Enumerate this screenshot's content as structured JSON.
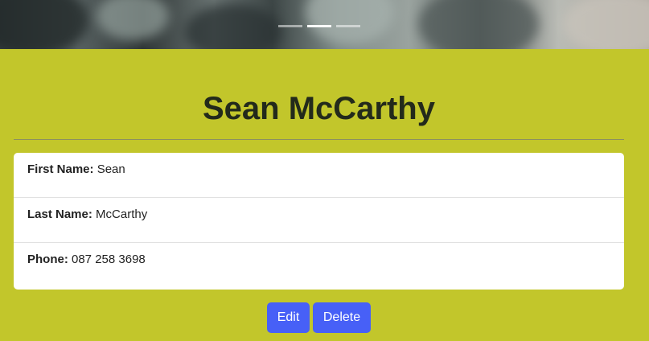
{
  "carousel": {
    "slides": 3,
    "active_index": 1
  },
  "profile": {
    "title": "Sean McCarthy",
    "fields": [
      {
        "label": "First Name:",
        "value": "Sean"
      },
      {
        "label": "Last Name:",
        "value": "McCarthy"
      },
      {
        "label": "Phone:",
        "value": "087 258 3698"
      }
    ]
  },
  "actions": {
    "edit_label": "Edit",
    "delete_label": "Delete"
  },
  "colors": {
    "background": "#c2c62b",
    "button": "#4760f7",
    "card": "#ffffff"
  }
}
